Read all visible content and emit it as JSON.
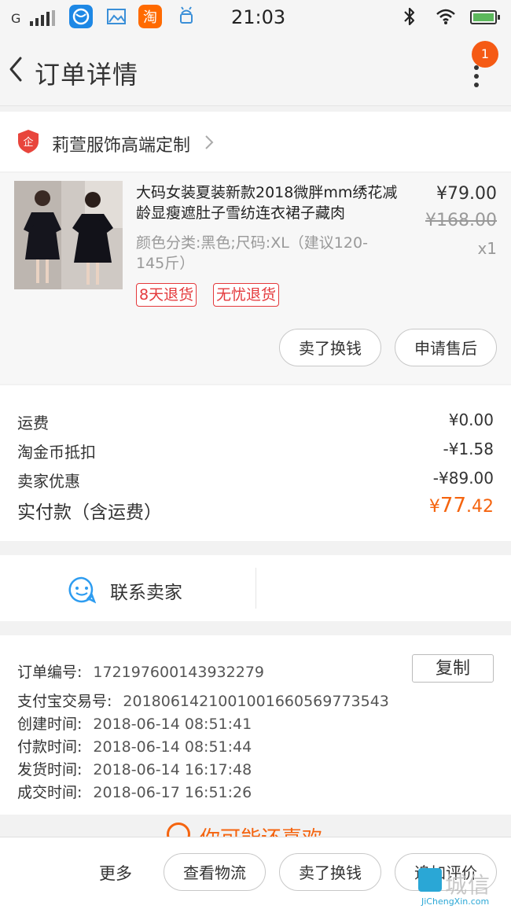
{
  "status_bar": {
    "carrier": "G",
    "time": "21:03"
  },
  "header": {
    "title": "订单详情",
    "badge_count": "1"
  },
  "shop": {
    "name": "莉萱服饰高端定制"
  },
  "product": {
    "title": "大码女装夏装新款2018微胖mm绣花减龄显瘦遮肚子雪纺连衣裙子藏肉",
    "price": "¥79.00",
    "original_price": "¥168.00",
    "quantity": "x1",
    "spec": "颜色分类:黑色;尺码:XL（建议120-145斤）",
    "tags": [
      "8天退货",
      "无忧退货"
    ],
    "actions": [
      "卖了换钱",
      "申请售后"
    ]
  },
  "fees": {
    "rows": [
      {
        "label": "运费",
        "value": "¥0.00"
      },
      {
        "label": "淘金币抵扣",
        "value": "-¥1.58"
      },
      {
        "label": "卖家优惠",
        "value": "-¥89.00"
      }
    ],
    "total_label": "实付款（含运费）",
    "total_currency": "¥",
    "total_int": "77",
    "total_dec": ".42"
  },
  "contact": {
    "label": "联系卖家"
  },
  "order_info": {
    "copy_label": "复制",
    "rows": [
      {
        "label": "订单编号:",
        "value": "172197600143932279"
      },
      {
        "label": "支付宝交易号:",
        "value": "2018061421001001660569773543"
      },
      {
        "label": "创建时间:",
        "value": "2018-06-14 08:51:41"
      },
      {
        "label": "付款时间:",
        "value": "2018-06-14 08:51:44"
      },
      {
        "label": "发货时间:",
        "value": "2018-06-14 16:17:48"
      },
      {
        "label": "成交时间:",
        "value": "2018-06-17 16:51:26"
      }
    ]
  },
  "guess": {
    "text": "你可能还喜欢"
  },
  "bottom_bar": {
    "more": "更多",
    "buttons": [
      "查看物流",
      "卖了换钱",
      "追加评价"
    ]
  },
  "watermark": {
    "text": "城信",
    "url": "JiChengXin.com"
  },
  "colors": {
    "accent": "#f5640f",
    "badge": "#f55a14",
    "tag_red": "#e4393c"
  }
}
